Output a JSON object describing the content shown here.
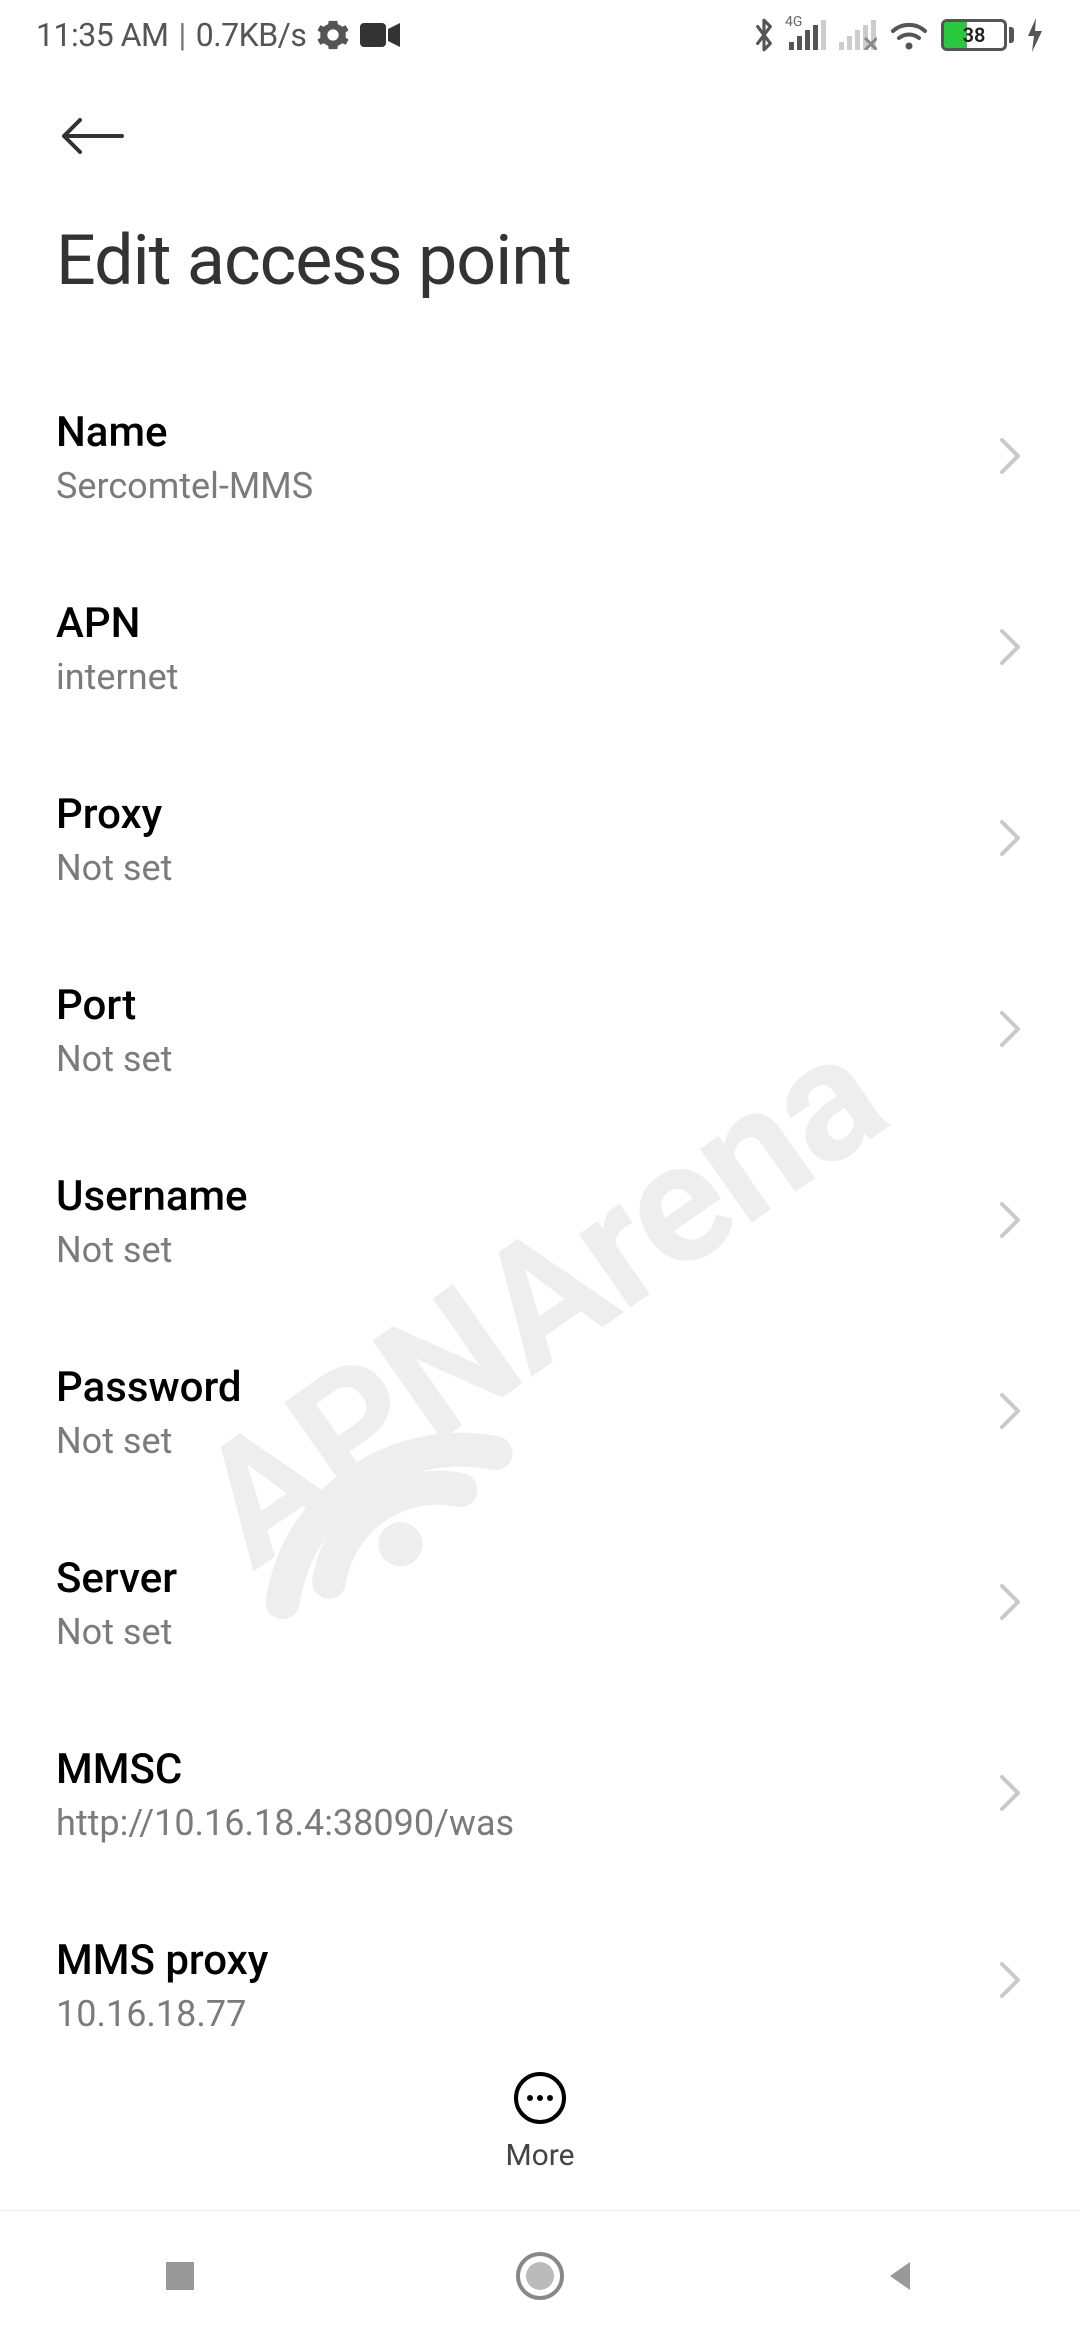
{
  "status": {
    "time": "11:35 AM",
    "sep": "|",
    "speed": "0.7KB/s",
    "network_label": "4G",
    "battery_pct": "38"
  },
  "header": {
    "title": "Edit access point"
  },
  "settings": [
    {
      "label": "Name",
      "value": "Sercomtel-MMS"
    },
    {
      "label": "APN",
      "value": "internet"
    },
    {
      "label": "Proxy",
      "value": "Not set"
    },
    {
      "label": "Port",
      "value": "Not set"
    },
    {
      "label": "Username",
      "value": "Not set"
    },
    {
      "label": "Password",
      "value": "Not set"
    },
    {
      "label": "Server",
      "value": "Not set"
    },
    {
      "label": "MMSC",
      "value": "http://10.16.18.4:38090/was"
    },
    {
      "label": "MMS proxy",
      "value": "10.16.18.77"
    }
  ],
  "footer": {
    "more_label": "More"
  },
  "watermark": "APNArena"
}
